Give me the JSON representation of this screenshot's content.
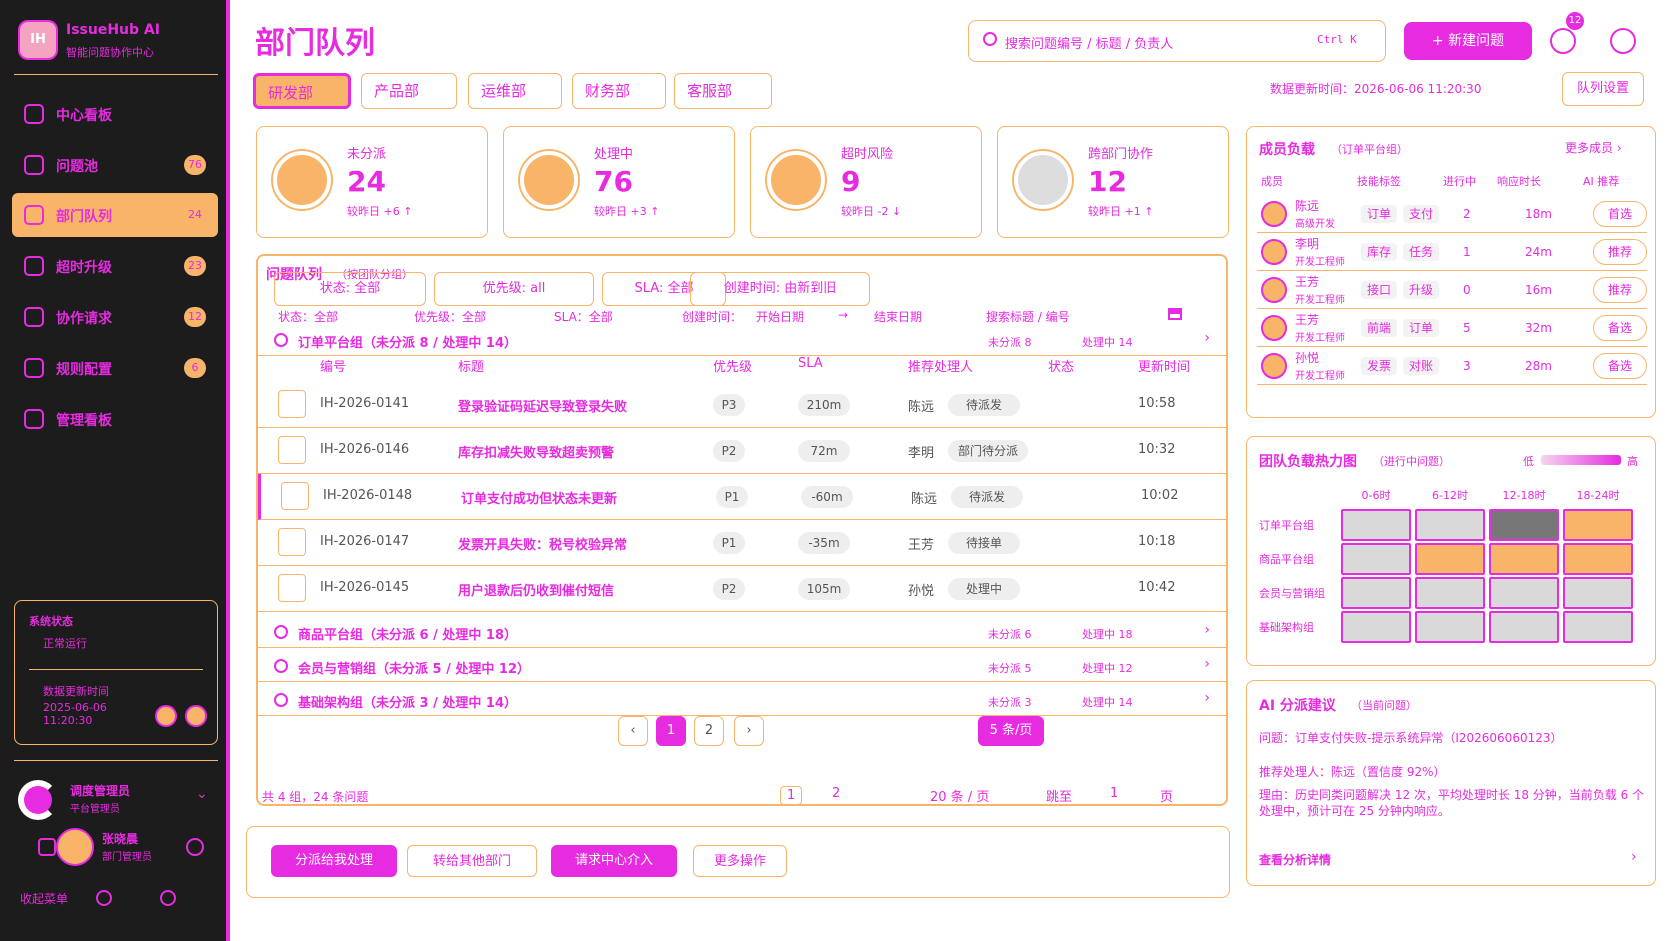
{
  "app": {
    "name": "IssueHub AI",
    "subtitle": "智能问题协作中心",
    "logo_text": "IH"
  },
  "sidebar": {
    "items": [
      {
        "label": "中心看板",
        "badge": ""
      },
      {
        "label": "问题池",
        "badge": "76"
      },
      {
        "label": "部门队列",
        "badge": "24",
        "active": true
      },
      {
        "label": "超时升级",
        "badge": "23"
      },
      {
        "label": "协作请求",
        "badge": "12"
      },
      {
        "label": "规则配置",
        "badge": "6"
      },
      {
        "label": "管理看板",
        "badge": ""
      }
    ],
    "system_status": {
      "title": "系统状态",
      "value": "正常运行",
      "updated_label": "数据更新时间",
      "updated_value": "2025-06-06 11:20:30"
    },
    "user1": {
      "name": "调度管理员",
      "role": "平台管理员"
    },
    "user2": {
      "name": "张晓晨",
      "role": "部门管理员"
    },
    "footer_label": "收起菜单"
  },
  "header": {
    "title": "部门队列",
    "search_placeholder": "搜索问题编号 / 标题 / 负责人",
    "search_shortcut": "Ctrl K",
    "new_button": "+ 新建问题",
    "notification_count": "12",
    "updated_time": "数据更新时间：2026-06-06 11:20:30",
    "config_button": "队列设置"
  },
  "tabs": [
    "研发部",
    "产品部",
    "运维部",
    "财务部",
    "客服部"
  ],
  "stats": [
    {
      "title": "未分派",
      "value": "24",
      "compare": "较昨日 +6 ↑"
    },
    {
      "title": "处理中",
      "value": "76",
      "compare": "较昨日 +3 ↑"
    },
    {
      "title": "超时风险",
      "value": "9",
      "compare": "较昨日 -2 ↓"
    },
    {
      "title": "跨部门协作",
      "value": "12",
      "compare": "较昨日 +1 ↑"
    }
  ],
  "queue": {
    "title": "问题队列",
    "title_hint": "（按团队分组）",
    "filters": [
      "状态: 全部",
      "优先级: all",
      "SLA: 全部",
      "创建时间: 由新到旧"
    ],
    "filter_row": {
      "status": "状态：全部",
      "priority": "优先级：全部",
      "sla": "SLA：全部",
      "created": "创建时间：",
      "start": "开始日期",
      "arrow": "→",
      "end": "结束日期",
      "search": "搜索标题 / 编号"
    },
    "columns": [
      "编号",
      "标题",
      "优先级",
      "SLA",
      "推荐处理人",
      "状态",
      "更新时间"
    ],
    "groups": [
      {
        "label": "订单平台组（未分派 8 / 处理中 14）",
        "unassigned": "未分派 8",
        "processing": "处理中 14"
      },
      {
        "label": "商品平台组（未分派 6 / 处理中 18）",
        "unassigned": "未分派 6",
        "processing": "处理中 18"
      },
      {
        "label": "会员与营销组（未分派 5 / 处理中 12）",
        "unassigned": "未分派 5",
        "processing": "处理中 12"
      },
      {
        "label": "基础架构组（未分派 3 / 处理中 14）",
        "unassigned": "未分派 3",
        "processing": "处理中 14"
      }
    ],
    "rows": [
      {
        "id": "IH-2026-0141",
        "title": "登录验证码延迟导致登录失败",
        "priority": "P3",
        "sla": "210m",
        "assignee": "陈远",
        "status": "待派发",
        "time": "10:58"
      },
      {
        "id": "IH-2026-0146",
        "title": "库存扣减失败导致超卖预警",
        "priority": "P2",
        "sla": "72m",
        "assignee": "李明",
        "status": "部门待分派",
        "time": "10:32"
      },
      {
        "id": "IH-2026-0148",
        "title": "订单支付成功但状态未更新",
        "priority": "P1",
        "sla": "-60m",
        "assignee": "陈远",
        "status": "待派发",
        "time": "10:02"
      },
      {
        "id": "IH-2026-0147",
        "title": "发票开具失败：税号校验异常",
        "priority": "P1",
        "sla": "-35m",
        "assignee": "王芳",
        "status": "待接单",
        "time": "10:18"
      },
      {
        "id": "IH-2026-0145",
        "title": "用户退款后仍收到催付短信",
        "priority": "P2",
        "sla": "105m",
        "assignee": "孙悦",
        "status": "处理中",
        "time": "10:42"
      }
    ],
    "pages": [
      "‹",
      "1",
      "2",
      "›"
    ],
    "page_size": "5 条/页",
    "total": "共 4 组，24 条问题",
    "bottom_pager": {
      "page1": "1",
      "page2": "2",
      "size": "20 条 / 页",
      "jump": "跳至",
      "jump_value": "1",
      "unit": "页"
    }
  },
  "actions": {
    "claim": "分派给我处理",
    "transfer": "转给其他部门",
    "request": "请求中心介入",
    "more": "更多操作"
  },
  "members": {
    "title": "成员负载",
    "title_hint": "（订单平台组）",
    "more": "更多成员 ›",
    "columns": [
      "成员",
      "技能标签",
      "进行中",
      "响应时长",
      "AI 推荐"
    ],
    "rows": [
      {
        "name": "陈远",
        "role": "高级开发",
        "skills": [
          "订单",
          "支付"
        ],
        "active": "2",
        "resp": "18m",
        "action": "首选"
      },
      {
        "name": "李明",
        "role": "开发工程师",
        "skills": [
          "库存",
          "任务"
        ],
        "active": "1",
        "resp": "24m",
        "action": "推荐"
      },
      {
        "name": "王芳",
        "role": "开发工程师",
        "skills": [
          "接口",
          "升级"
        ],
        "active": "0",
        "resp": "16m",
        "action": "推荐"
      },
      {
        "name": "王芳",
        "role": "开发工程师",
        "skills": [
          "前端",
          "订单"
        ],
        "active": "5",
        "resp": "32m",
        "action": "备选"
      },
      {
        "name": "孙悦",
        "role": "开发工程师",
        "skills": [
          "发票",
          "对账"
        ],
        "active": "3",
        "resp": "28m",
        "action": "备选"
      }
    ]
  },
  "heatmap": {
    "title": "团队负载热力图",
    "title_hint": "（进行中问题）",
    "legend_low": "低",
    "legend_high": "高",
    "columns": [
      "0-6时",
      "6-12时",
      "12-18时",
      "18-24时"
    ],
    "rows": [
      "订单平台组",
      "商品平台组",
      "会员与营销组",
      "基础架构组"
    ],
    "levels": [
      [
        1,
        1,
        3,
        2
      ],
      [
        1,
        2,
        2,
        2
      ],
      [
        1,
        1,
        1,
        1
      ],
      [
        1,
        1,
        1,
        1
      ]
    ]
  },
  "ai": {
    "title": "AI 分派建议",
    "title_hint": "（当前问题）",
    "issue": "问题：订单支付失败-提示系统异常（I202606060123）",
    "assignee": "推荐处理人：陈远（置信度 92%）",
    "reason": "理由：历史同类问题解决 12 次，平均处理时长 18 分钟，当前负载 6 个处理中，预计可在 25 分钟内响应。",
    "detail_link": "查看分析详情"
  },
  "colors": {
    "accent": "#e62be0",
    "secondary": "#f8b56a",
    "sidebar": "#1c1c1c"
  }
}
